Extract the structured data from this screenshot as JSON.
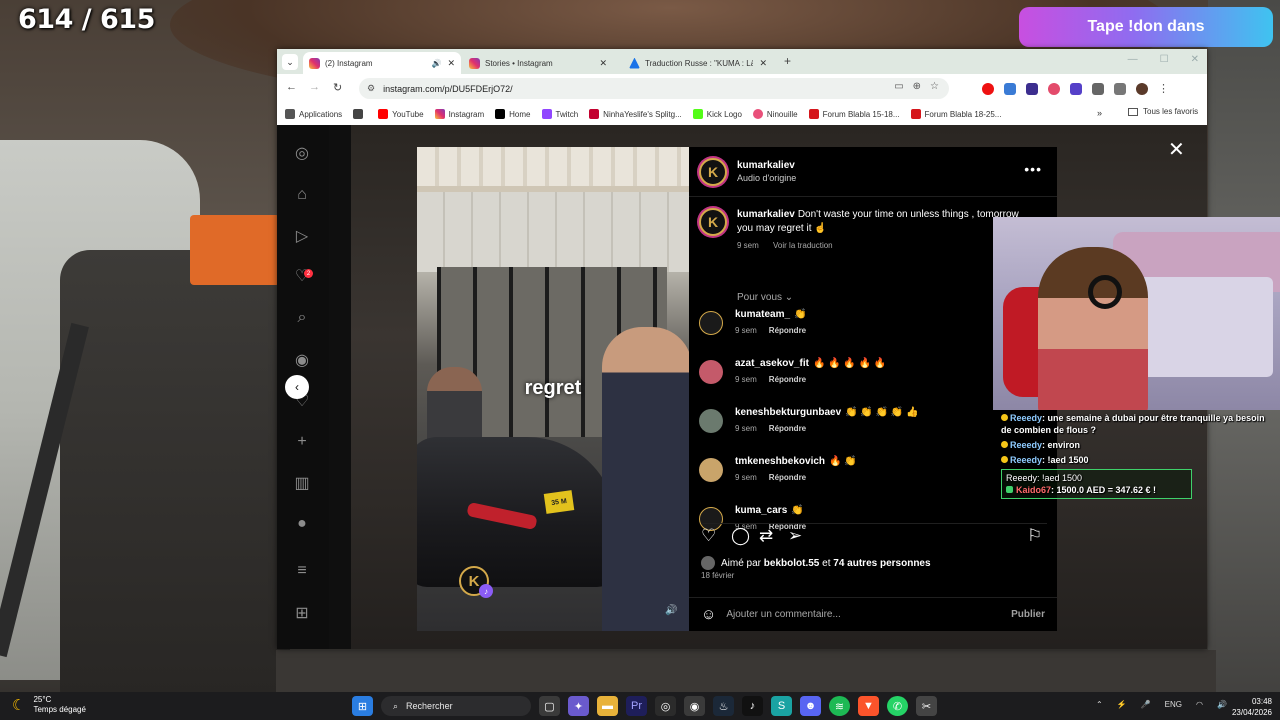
{
  "stream": {
    "counter": "614 / 615",
    "don_banner": "Tape !don dans"
  },
  "browser": {
    "tabs": [
      {
        "label": "(2) Instagram",
        "icon": "instagram-icon"
      },
      {
        "label": "Stories • Instagram",
        "icon": "instagram-icon"
      },
      {
        "label": "Traduction Russe : \"KUMA : Là\"",
        "icon": "translate-icon"
      }
    ],
    "url": "instagram.com/p/DU5FDErjO72/",
    "bookmarks": [
      {
        "label": "Applications",
        "icon": "apps-grid-icon",
        "color": "#555555"
      },
      {
        "label": "YouTube",
        "icon": "youtube-icon",
        "color": "#ff0000"
      },
      {
        "label": "Instagram",
        "icon": "instagram-icon",
        "color": "#e1306c"
      },
      {
        "label": "Home",
        "icon": "x-icon",
        "color": "#000000"
      },
      {
        "label": "Twitch",
        "icon": "twitch-icon",
        "color": "#9146ff"
      },
      {
        "label": "NinhaYeslife's Splitg...",
        "icon": "splitgate-icon",
        "color": "#c3002f"
      },
      {
        "label": "Kick Logo",
        "icon": "kick-icon",
        "color": "#53fc18"
      },
      {
        "label": "Ninouille",
        "icon": "ninouille-icon",
        "color": "#e9507a"
      },
      {
        "label": "Forum Blabla 15-18...",
        "icon": "jvc-icon",
        "color": "#d5161b"
      },
      {
        "label": "Forum Blabla 18-25...",
        "icon": "jvc-icon",
        "color": "#d5161b"
      }
    ],
    "bookmarks_all": "Tous les favoris"
  },
  "post": {
    "username": "kumarkaliev",
    "audio": "Audio d'origine",
    "caption_user": "kumarkaliev",
    "caption_text": "Don't waste your time on unless things , tomorrow you may regret it ☝️",
    "caption_time": "9 sem",
    "see_translation": "Voir la traduction",
    "for_you": "Pour vous ⌄",
    "video_caption": "regret",
    "plate": "35 M",
    "comments": [
      {
        "user": "kumateam_",
        "text": "👏",
        "time": "9 sem",
        "reply": "Répondre",
        "color": "#1a1a1a"
      },
      {
        "user": "azat_asekov_fit",
        "text": "🔥 🔥 🔥 🔥 🔥",
        "time": "9 sem",
        "reply": "Répondre",
        "color": "#c45a6a"
      },
      {
        "user": "keneshbekturgunbaev",
        "text": "👏 👏 👏 👏 👍",
        "time": "9 sem",
        "reply": "Répondre",
        "color": "#6b7a6e"
      },
      {
        "user": "tmkeneshbekovich",
        "text": "🔥 👏",
        "time": "9 sem",
        "reply": "Répondre",
        "color": "#c9a46a"
      },
      {
        "user": "kuma_cars",
        "text": "👏",
        "time": "9 sem",
        "reply": "Répondre",
        "color": "#1a1a1a"
      }
    ],
    "liked_prefix": "Aimé par",
    "liked_user": "bekbolot.55",
    "liked_mid": "et",
    "liked_count": "74 autres personnes",
    "date": "18 février",
    "comment_placeholder": "Ajouter un commentaire...",
    "publish": "Publier"
  },
  "chat": [
    {
      "user": "Reeedy",
      "text": ": une semaine à dubai pour être tranquille ya besoin de combien de flous ?"
    },
    {
      "user": "Reeedy",
      "text": ": environ"
    },
    {
      "user": "Reeedy",
      "text": ": !aed 1500"
    }
  ],
  "chat_highlight": {
    "line1": "Reeedy: !aed 1500",
    "user": "Kaido67",
    "text": ": 1500.0 AED = 347.62 € !"
  },
  "taskbar": {
    "temp": "25°C",
    "weather": "Temps dégagé",
    "search": "Rechercher",
    "lang": "ENG",
    "time": "03:48",
    "date": "23/04/2026"
  }
}
